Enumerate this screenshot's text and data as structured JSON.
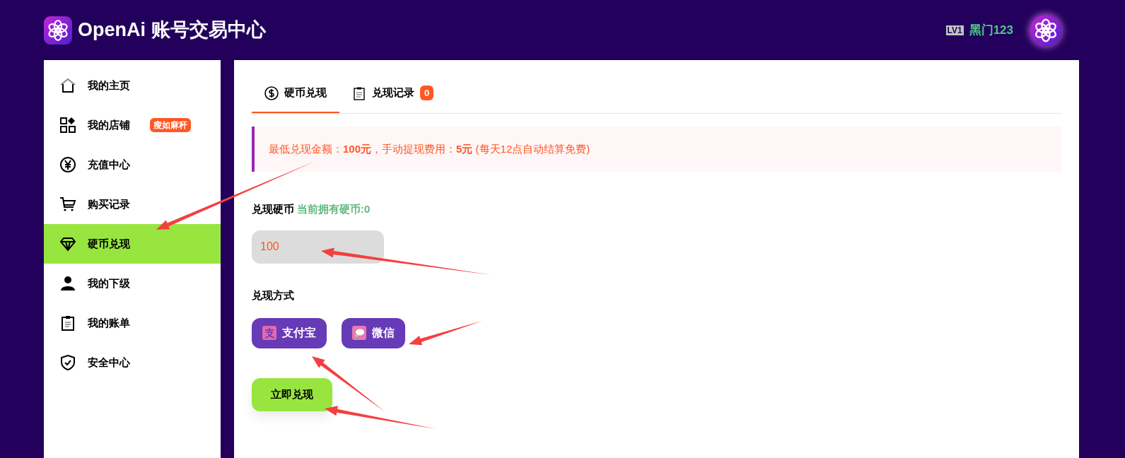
{
  "header": {
    "title": "OpenAi 账号交易中心",
    "level_badge": "LV1",
    "username": "黑门123"
  },
  "sidebar": {
    "items": [
      {
        "kind": "home",
        "label": "我的主页",
        "selected": false
      },
      {
        "kind": "shop",
        "label": "我的店铺",
        "badge": "瘦如麻秆",
        "selected": false
      },
      {
        "kind": "yen",
        "label": "充值中心",
        "selected": false
      },
      {
        "kind": "cart",
        "label": "购买记录",
        "selected": false
      },
      {
        "kind": "diamond",
        "label": "硬币兑现",
        "selected": true
      },
      {
        "kind": "user",
        "label": "我的下级",
        "selected": false
      },
      {
        "kind": "bill",
        "label": "我的账单",
        "selected": false
      },
      {
        "kind": "shield",
        "label": "安全中心",
        "selected": false
      }
    ]
  },
  "tabs": [
    {
      "kind": "dollar",
      "label": "硬币兑现",
      "selected": true
    },
    {
      "kind": "clipboard",
      "label": "兑现记录",
      "badge": "0",
      "selected": false
    }
  ],
  "notice": "最低兑现金额：**100元**，手动提现费用：**5元** (每天12点自动结算免费)",
  "coins": {
    "label": "兑现硬币",
    "hint": "当前拥有硬币:0",
    "value": "100"
  },
  "method": {
    "label": "兑现方式",
    "options": [
      {
        "kind": "alipay",
        "label": "支付宝"
      },
      {
        "kind": "wechat",
        "label": "微信"
      }
    ]
  },
  "submit": "立即兑现"
}
